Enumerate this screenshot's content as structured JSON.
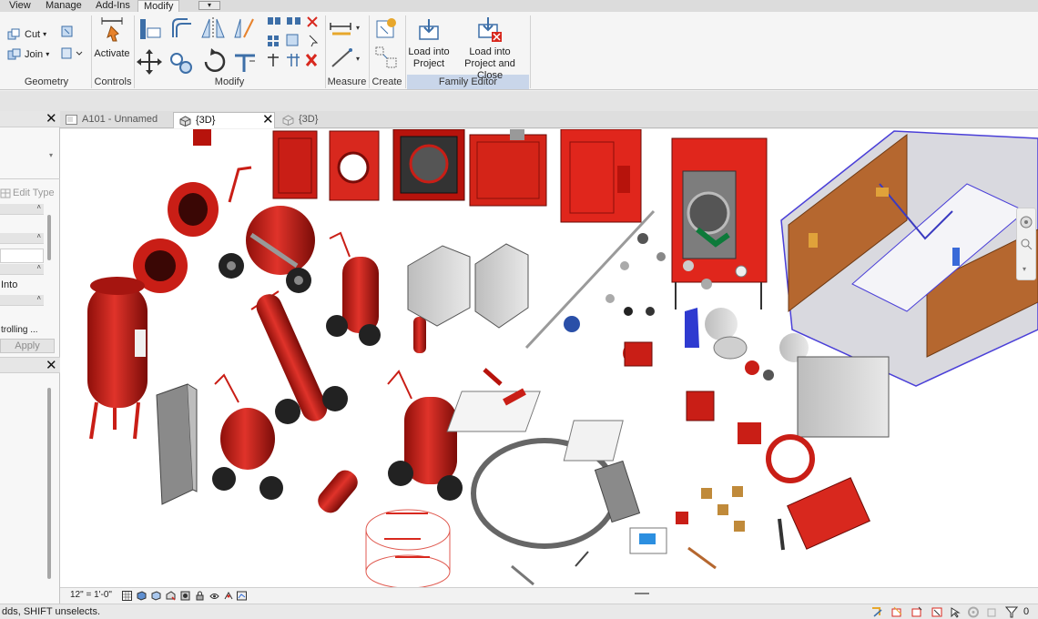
{
  "ribbon_tabs": [
    {
      "label": "View"
    },
    {
      "label": "Manage"
    },
    {
      "label": "Add-Ins"
    },
    {
      "label": "Modify",
      "active": true
    }
  ],
  "qat_dropdown": "▾",
  "geometry": {
    "cut_label": "Cut",
    "join_label": "Join",
    "title": "Geometry"
  },
  "controls": {
    "activate_label": "Activate",
    "title": "Controls"
  },
  "modify": {
    "title": "Modify"
  },
  "measure": {
    "title": "Measure"
  },
  "create": {
    "title": "Create"
  },
  "family_editor": {
    "title": "Family Editor",
    "load_into_project": [
      "Load into",
      "Project"
    ],
    "load_into_project_close": [
      "Load into",
      "Project and Close"
    ]
  },
  "properties": {
    "edit_type_label": "Edit Type",
    "field_into": "Into",
    "field_controlling": "trolling ...",
    "apply_label": "Apply"
  },
  "view_tabs": [
    {
      "label": "A101 - Unnamed",
      "active": false
    },
    {
      "label": "{3D}",
      "active": true
    },
    {
      "label": "{3D}",
      "active": false
    }
  ],
  "view_bar": {
    "scale": "12\" = 1'-0\""
  },
  "status": {
    "text": "dds, SHIFT unselects.",
    "filter_count": "0"
  },
  "colors": {
    "accent_red": "#d8281e",
    "family_editor_band": "#c9d6ea",
    "ribbon_bg": "#f5f5f5"
  }
}
